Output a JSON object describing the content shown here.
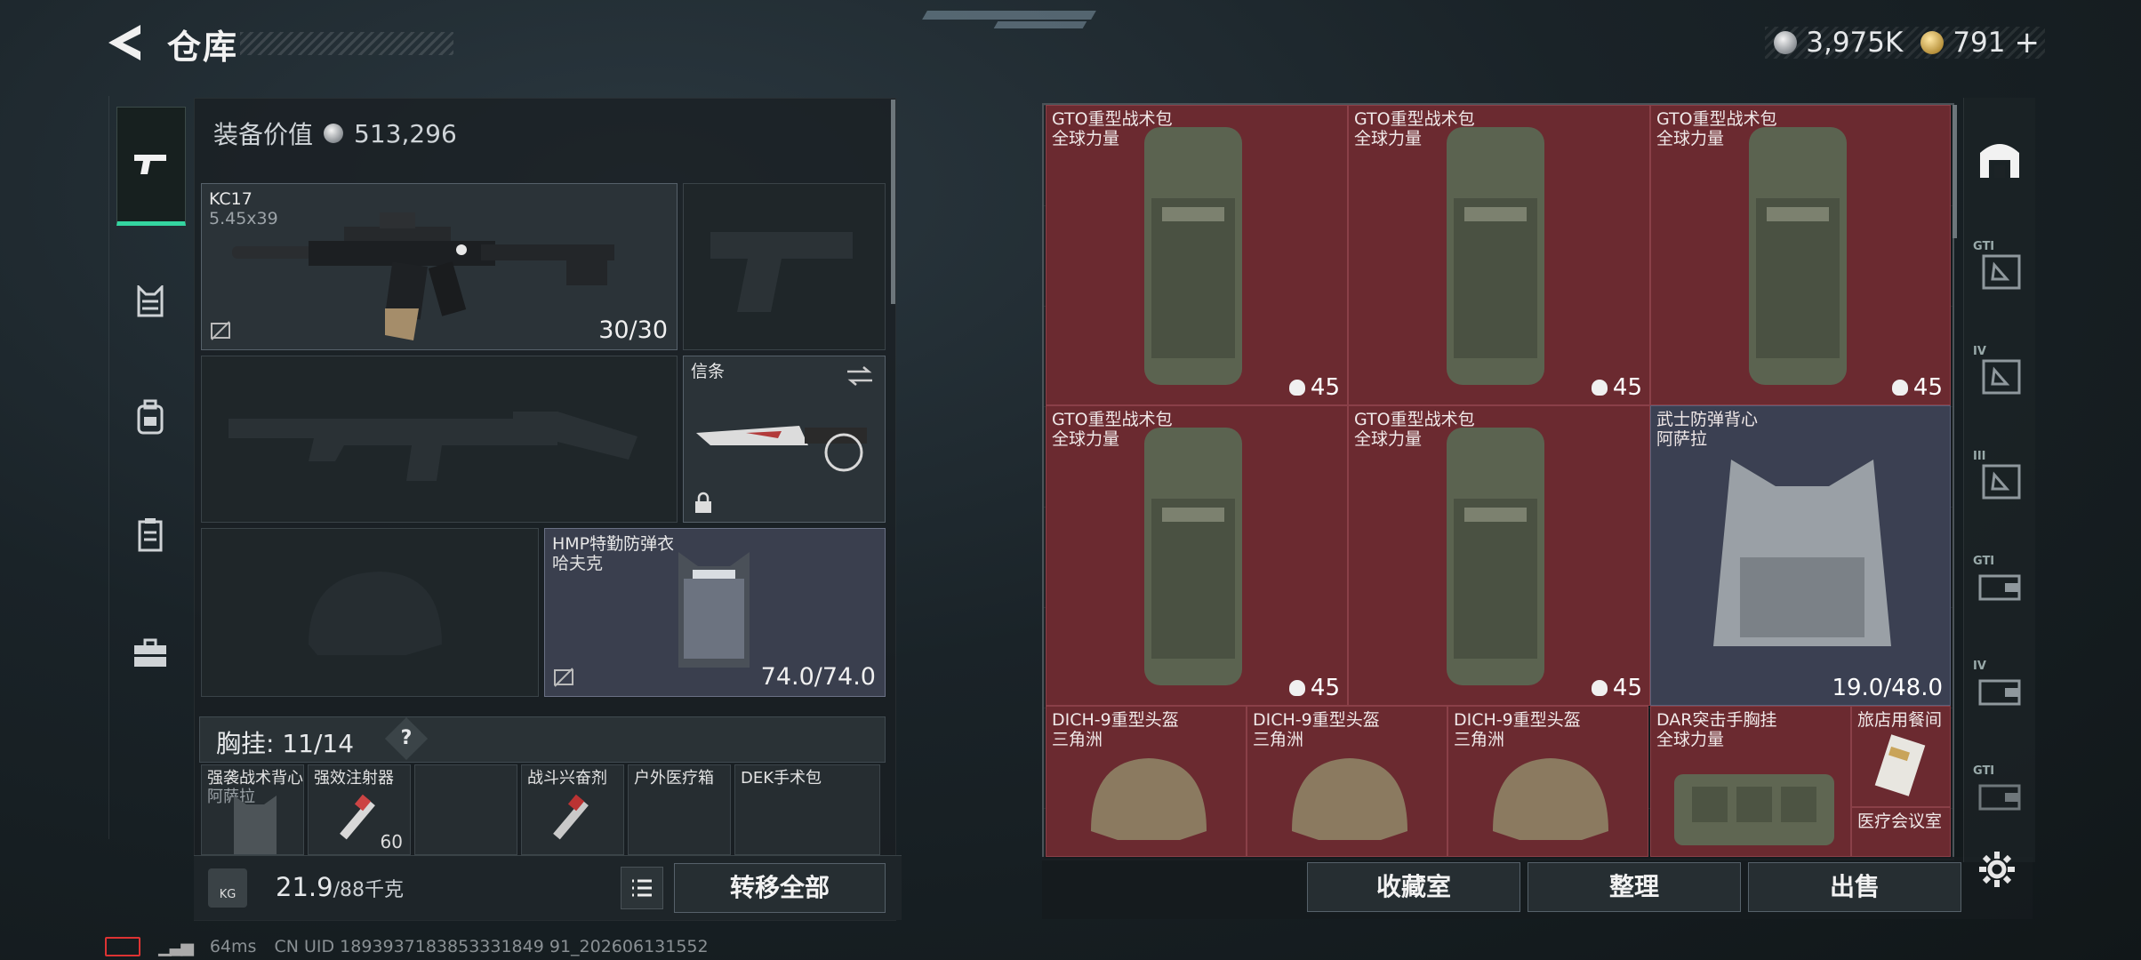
{
  "header": {
    "title": "仓库",
    "silver": "3,975K",
    "gold": "791",
    "add": "+"
  },
  "equipment": {
    "value_label": "装备价值",
    "value": "513,296",
    "primary": {
      "name": "KC17",
      "caliber": "5.45x39",
      "ammo": "30/30"
    },
    "melee": {
      "name": "信条"
    },
    "armor": {
      "name": "HMP特勤防弹衣",
      "sub": "哈夫克",
      "durability": "74.0/74.0"
    },
    "chest_label": "胸挂:",
    "chest_count": "11/14",
    "help": "?",
    "chest_items": [
      {
        "name": "强袭战术背心",
        "sub": "阿萨拉"
      },
      {
        "name": "强效注射器",
        "sub": "",
        "count": "60"
      },
      {
        "name": "",
        "sub": ""
      },
      {
        "name": "战斗兴奋剂",
        "sub": ""
      },
      {
        "name": "户外医疗箱",
        "sub": ""
      },
      {
        "name": "DEK手术包",
        "sub": ""
      }
    ]
  },
  "weight": {
    "current": "21.9",
    "max": "/88千克",
    "kg_icon": "KG"
  },
  "actions": {
    "transfer_all": "转移全部",
    "collection": "收藏室",
    "organize": "整理",
    "sell": "出售"
  },
  "stash": {
    "items": [
      {
        "name": "GTO重型战术包",
        "sub": "全球力量",
        "count": "45",
        "kind": "backpack"
      },
      {
        "name": "GTO重型战术包",
        "sub": "全球力量",
        "count": "45",
        "kind": "backpack"
      },
      {
        "name": "GTO重型战术包",
        "sub": "全球力量",
        "count": "45",
        "kind": "backpack"
      },
      {
        "name": "GTO重型战术包",
        "sub": "全球力量",
        "count": "45",
        "kind": "backpack"
      },
      {
        "name": "GTO重型战术包",
        "sub": "全球力量",
        "count": "45",
        "kind": "backpack"
      },
      {
        "name": "武士防弹背心",
        "sub": "阿萨拉",
        "count": "19.0/48.0",
        "kind": "vest"
      },
      {
        "name": "DICH-9重型头盔",
        "sub": "三角洲",
        "kind": "helmet"
      },
      {
        "name": "DICH-9重型头盔",
        "sub": "三角洲",
        "kind": "helmet"
      },
      {
        "name": "DICH-9重型头盔",
        "sub": "三角洲",
        "kind": "helmet"
      },
      {
        "name": "DAR突击手胸挂",
        "sub": "全球力量",
        "kind": "rig"
      },
      {
        "name": "旅店用餐间",
        "sub": "",
        "kind": "card"
      },
      {
        "name": "医疗会议室",
        "sub": "",
        "kind": "card"
      }
    ]
  },
  "right_tabs": [
    "",
    "GTI",
    "IV",
    "III",
    "GTI",
    "IV",
    "GTI"
  ],
  "status": {
    "ping": "64ms",
    "uid": "CN UID 1893937183853331849 91_202606131552"
  }
}
